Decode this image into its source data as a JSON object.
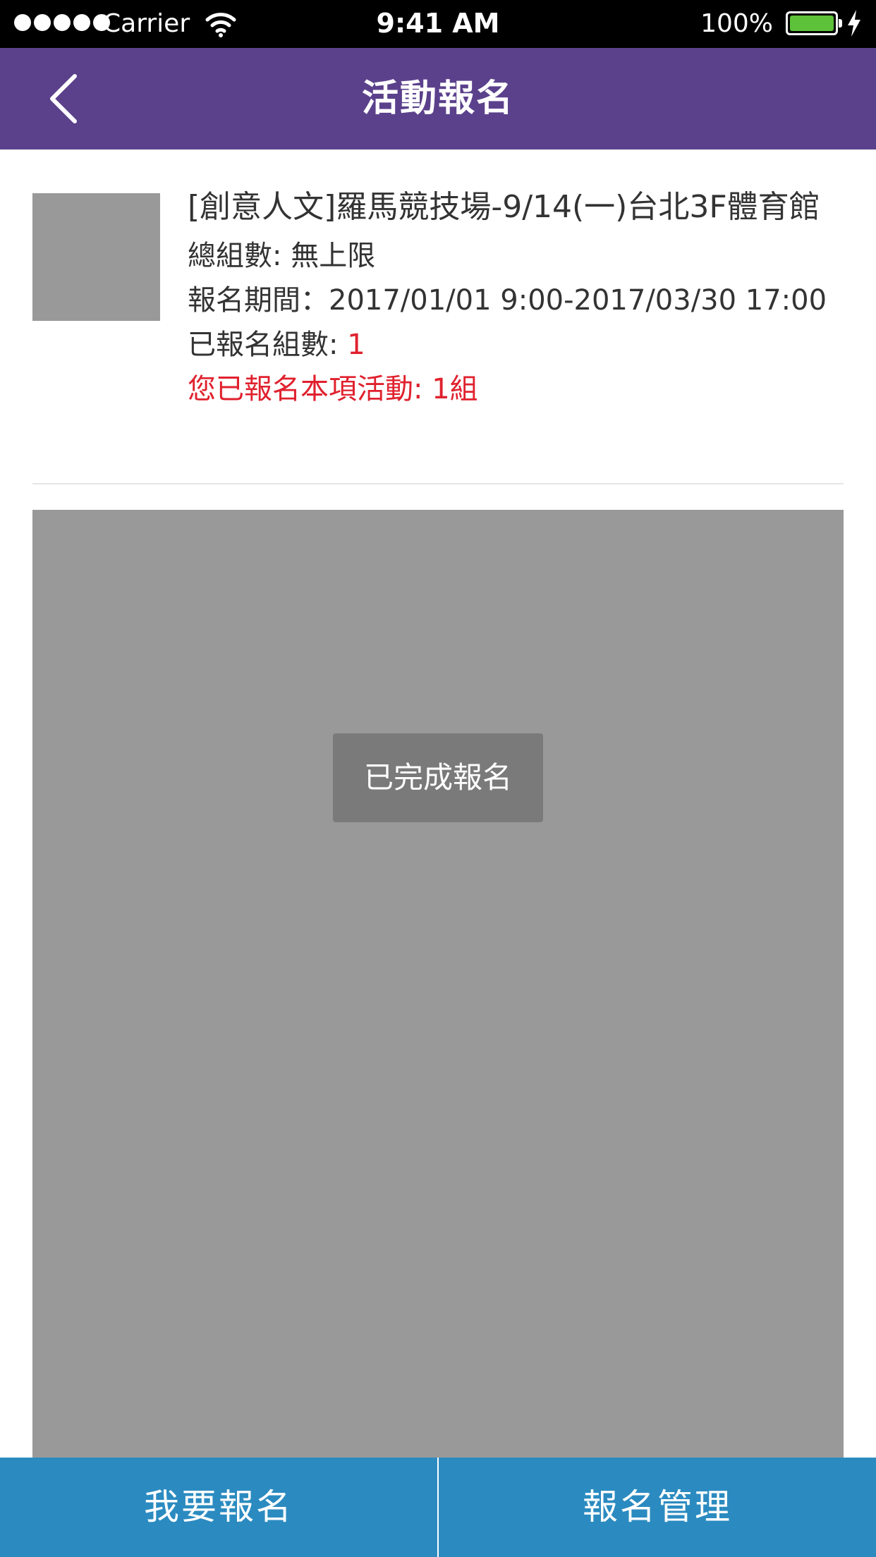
{
  "status_bar": {
    "carrier": "Carrier",
    "time": "9:41 AM",
    "battery": "100%",
    "battery_color": "#5dc23a",
    "icons": [
      "signal-dots-icon",
      "wifi-icon",
      "battery-icon",
      "charging-bolt-icon"
    ]
  },
  "header": {
    "title": "活動報名",
    "background": "#5b418c",
    "back_icon": "chevron-left-icon"
  },
  "event": {
    "title": "[創意人文]羅馬競技場-9/14(一)台北3F體育館",
    "total_groups_label": "總組數: ",
    "total_groups_value": "無上限",
    "period_label": "報名期間：",
    "period_value": "2017/01/01 9:00-2017/03/30 17:00",
    "registered_label": "已報名組數: ",
    "registered_value": "1",
    "my_registration": "您已報名本項活動: 1組",
    "highlight_color": "#e0212e"
  },
  "banner": {
    "toast": "已完成報名"
  },
  "footer": {
    "background": "#2b8bc0",
    "register_button": "我要報名",
    "manage_button": "報名管理"
  }
}
